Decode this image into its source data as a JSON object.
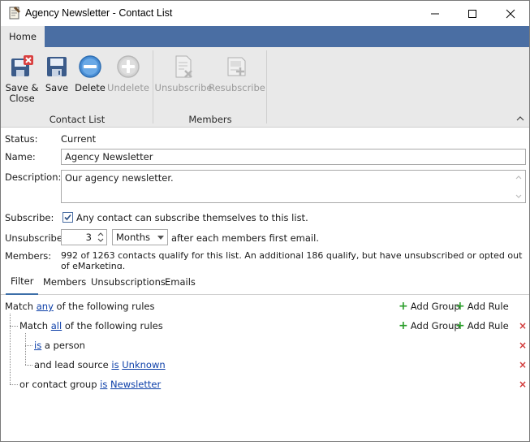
{
  "window": {
    "title": "Agency Newsletter - Contact List",
    "icon": "notepad-icon"
  },
  "ribbon": {
    "tab": "Home",
    "groups": [
      {
        "label": "Contact List",
        "buttons": [
          {
            "label_line1": "Save &",
            "label_line2": "Close",
            "icon": "save-close-icon",
            "enabled": true
          },
          {
            "label": "Save",
            "icon": "save-icon",
            "enabled": true
          },
          {
            "label": "Delete",
            "icon": "delete-icon",
            "enabled": true
          },
          {
            "label": "Undelete",
            "icon": "undelete-icon",
            "enabled": false
          }
        ]
      },
      {
        "label": "Members",
        "buttons": [
          {
            "label": "Unsubscribe",
            "icon": "unsubscribe-icon",
            "enabled": false
          },
          {
            "label": "Resubscribe",
            "icon": "resubscribe-icon",
            "enabled": false
          }
        ]
      }
    ]
  },
  "form": {
    "status_label": "Status:",
    "status_value": "Current",
    "name_label": "Name:",
    "name_value": "Agency Newsletter",
    "description_label": "Description:",
    "description_value": "Our agency newsletter.",
    "subscribe_label": "Subscribe:",
    "subscribe_checked": true,
    "subscribe_text": "Any contact can subscribe themselves to this list.",
    "unsubscribe_label": "Unsubscribe:",
    "unsubscribe_number": "3",
    "unsubscribe_unit": "Months",
    "unsubscribe_suffix": "after each members first email.",
    "members_label": "Members:",
    "members_text": "992 of 1263 contacts qualify for this list. An additional 186 qualify, but have unsubscribed or opted out of eMarketing."
  },
  "tabs": [
    "Filter",
    "Members",
    "Unsubscriptions",
    "Emails"
  ],
  "active_tab": "Filter",
  "rules": {
    "add_group": "Add Group",
    "add_rule": "Add Rule",
    "root": {
      "prefix": "Match ",
      "quantifier": "any",
      "suffix": " of the following rules"
    },
    "group": {
      "prefix": "Match ",
      "quantifier": "all",
      "suffix": " of the following rules"
    },
    "rule1": {
      "op": "is",
      "text": " a person"
    },
    "rule2": {
      "prefix": "and lead source ",
      "op": "is",
      "value": "Unknown"
    },
    "rule3": {
      "prefix": "or contact group ",
      "op": "is",
      "value": "Newsletter"
    }
  },
  "colors": {
    "ribbon_tab_bar": "#4a6ea3",
    "ribbon_body": "#e9e9e9",
    "link": "#0b3ea8",
    "add_plus": "#2a9d2a",
    "delete_x": "#d23b3b"
  }
}
